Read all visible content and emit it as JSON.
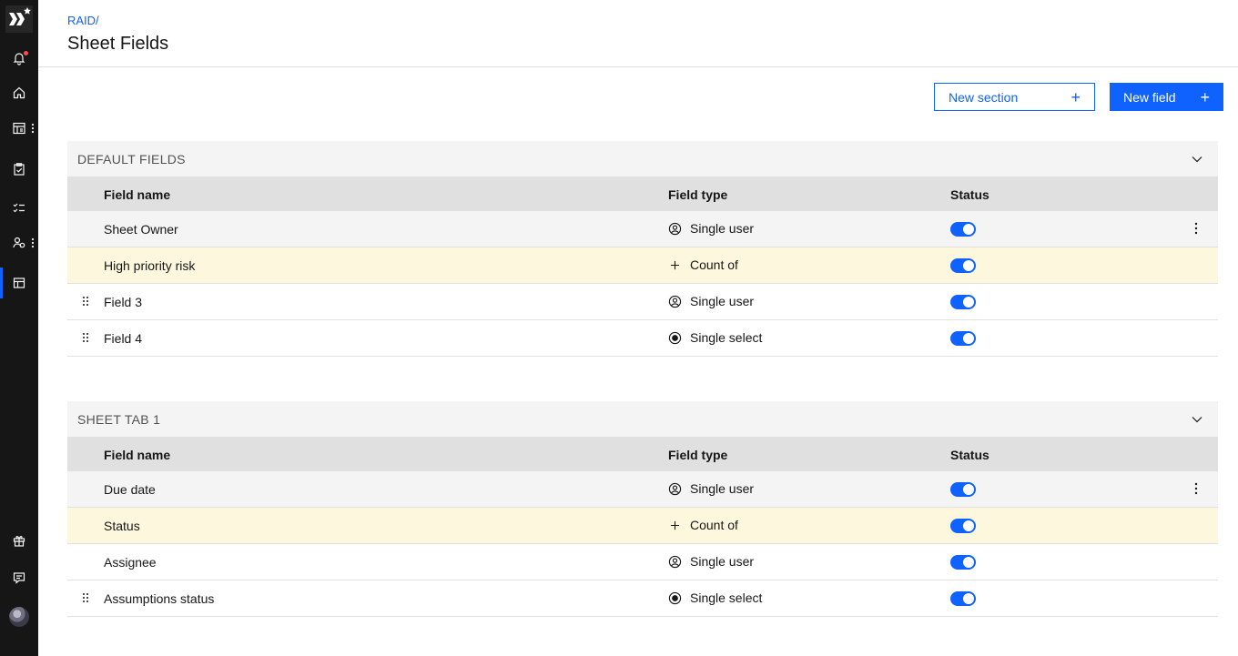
{
  "app": {
    "breadcrumb": "RAID/",
    "title": "Sheet Fields",
    "brand_color": "#0f62fe"
  },
  "sidebar": {
    "items": [
      {
        "icon": "bell-icon",
        "has_notification": true
      },
      {
        "icon": "home-icon"
      },
      {
        "icon": "dashboard-icon",
        "has_menu": true
      },
      {
        "icon": "clipboard-icon"
      },
      {
        "icon": "task-list-icon"
      },
      {
        "icon": "user-group-icon",
        "has_menu": true
      },
      {
        "icon": "layout-icon",
        "active": true
      },
      {
        "icon": "gift-icon"
      },
      {
        "icon": "chat-icon"
      }
    ]
  },
  "toolbar": {
    "new_section_label": "New section",
    "new_field_label": "New field"
  },
  "columns": {
    "name": "Field name",
    "type": "Field type",
    "status": "Status"
  },
  "sections": [
    {
      "title": "DEFAULT FIELDS",
      "rows": [
        {
          "name": "Sheet Owner",
          "type": "Single user",
          "type_icon": "user-icon",
          "status": true
        },
        {
          "name": "High priority risk",
          "type": "Count of",
          "type_icon": "plus-icon",
          "status": true
        },
        {
          "name": "Field 3",
          "type": "Single user",
          "type_icon": "user-icon",
          "status": true
        },
        {
          "name": "Field 4",
          "type": "Single select",
          "type_icon": "radio-icon",
          "status": true
        }
      ]
    },
    {
      "title": "SHEET TAB 1",
      "rows": [
        {
          "name": "Due date",
          "type": "Single user",
          "type_icon": "user-icon",
          "status": true
        },
        {
          "name": "Status",
          "type": "Count of",
          "type_icon": "plus-icon",
          "status": true
        },
        {
          "name": "Assignee",
          "type": "Single user",
          "type_icon": "user-icon",
          "status": true
        },
        {
          "name": "Assumptions status",
          "type": "Single select",
          "type_icon": "radio-icon",
          "status": true
        }
      ]
    }
  ]
}
